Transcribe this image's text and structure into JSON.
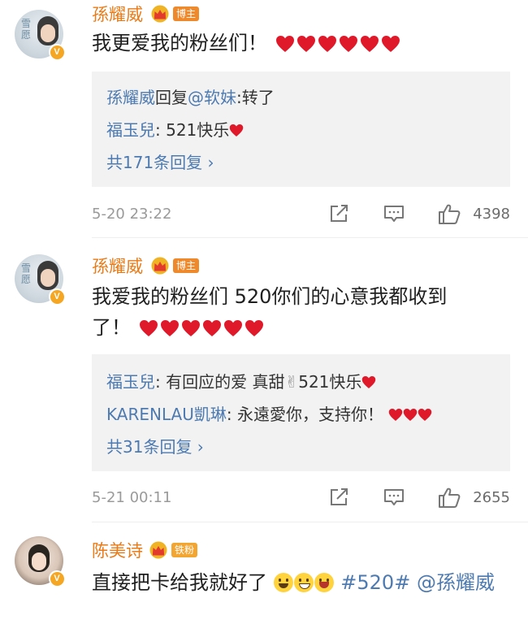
{
  "posts": [
    {
      "username": "孫耀威",
      "badge": "博主",
      "avatar_text": "雪愿",
      "text": "我更爱我的粉丝们！",
      "hearts": 6,
      "replies": [
        {
          "name": "孫耀威",
          "connector": "回复",
          "mention": "@软妹",
          "after": ":转了",
          "hearts": 0
        },
        {
          "name": "福玉兒",
          "connector": "",
          "mention": "",
          "after": ": 521快乐",
          "hearts": 1
        }
      ],
      "more_replies": "共171条回复 ›",
      "time": "5-20 23:22",
      "likes": "4398"
    },
    {
      "username": "孫耀威",
      "badge": "博主",
      "avatar_text": "雪愿",
      "text_line1": "我爱我的粉丝们 520你们的心意我都收到",
      "text_line2": "了！",
      "hearts": 6,
      "replies": [
        {
          "name": "福玉兒",
          "after": ": 有回应的爱 真甜",
          "emoji": "✌",
          "after2": "521快乐",
          "hearts": 1
        },
        {
          "name": "KARENLAU凱琳",
          "after": ": 永遠愛你，支持你！",
          "hearts": 3
        }
      ],
      "more_replies": "共31条回复 ›",
      "time": "5-21 00:11",
      "likes": "2655"
    },
    {
      "username": "陈美诗",
      "badge": "铁粉",
      "text_prefix": "直接把卡给我就好了",
      "hashtag": "#520#",
      "mention": "@孫耀威"
    }
  ],
  "icons": {
    "share": "share-icon",
    "comment": "comment-icon",
    "like": "thumbs-up-icon",
    "verified": "verified-v-badge-icon",
    "crown": "crown-icon",
    "heart": "red-heart-icon"
  },
  "colors": {
    "username": "#ea7a16",
    "link": "#4d7ab0",
    "heart": "#e0192a",
    "reply_bg": "#f2f2f2",
    "meta": "#9a9a9a"
  }
}
